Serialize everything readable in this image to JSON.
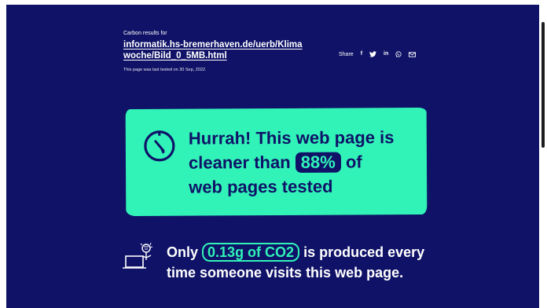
{
  "header": {
    "carbon_label": "Carbon results for",
    "url": "informatik.hs-bremerhaven.de/uerb/Klimawoche/Bild_0_5MB.html",
    "tested_text": "This page was last tested on 30 Sep, 2022."
  },
  "share": {
    "label": "Share",
    "icons": [
      "facebook-icon",
      "twitter-icon",
      "linkedin-icon",
      "whatsapp-icon",
      "email-icon"
    ],
    "facebook_glyph": "f",
    "linkedin_glyph": "in"
  },
  "result": {
    "line_1": "Hurrah! This web page is",
    "line_2_prefix": "cleaner than",
    "percent": "88%",
    "line_2_suffix": "of",
    "line_3": "web pages tested"
  },
  "co2": {
    "prefix": "Only",
    "amount": "0.13g of CO2",
    "suffix": "is produced every time someone visits this web page."
  },
  "colors": {
    "background": "#0f1267",
    "accent": "#31f3b8",
    "text": "#ffffff"
  }
}
